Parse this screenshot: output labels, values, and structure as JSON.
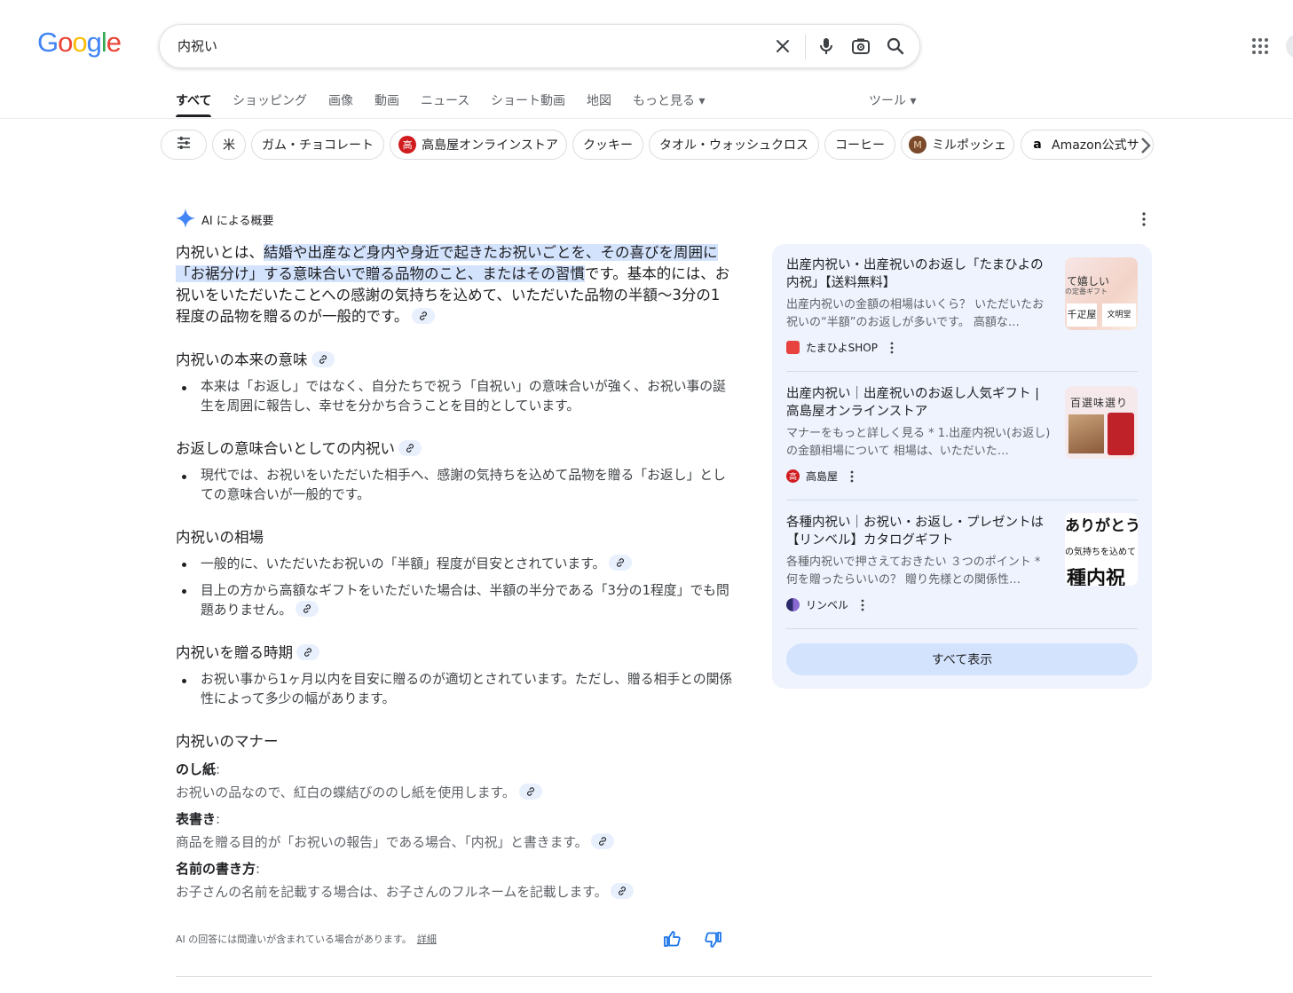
{
  "logo": [
    "G",
    "o",
    "o",
    "g",
    "l",
    "e"
  ],
  "logo_colors": [
    "#4285f4",
    "#ea4335",
    "#fbbc05",
    "#4285f4",
    "#34a853",
    "#ea4335"
  ],
  "search": {
    "query": "内祝い"
  },
  "tabs": [
    {
      "label": "すべて",
      "active": true
    },
    {
      "label": "ショッピング"
    },
    {
      "label": "画像"
    },
    {
      "label": "動画"
    },
    {
      "label": "ニュース"
    },
    {
      "label": "ショート動画"
    },
    {
      "label": "地図"
    },
    {
      "label": "もっと見る ▾"
    },
    {
      "label": "ツール ▾"
    }
  ],
  "chips": [
    {
      "label": ""
    },
    {
      "label": "米"
    },
    {
      "label": "ガム・チョコレート"
    },
    {
      "label": "高島屋オンラインストア",
      "icon": "高"
    },
    {
      "label": "クッキー"
    },
    {
      "label": "タオル・ウォッシュクロス"
    },
    {
      "label": "コーヒー"
    },
    {
      "label": "ミルポッシェ",
      "icon": "M"
    },
    {
      "label": "Amazon公式サ",
      "icon": "a"
    }
  ],
  "ai": {
    "title": "AI による概要",
    "intro_before": "内祝いとは、",
    "intro_highlight": "結婚や出産など身内や身近で起きたお祝いごとを、その喜びを周囲に「お裾分け」する意味合いで贈る品物のこと、またはその習慣",
    "intro_after": "です。基本的には、お祝いをいただいたことへの感謝の気持ちを込めて、いただいた品物の半額〜3分の1程度の品物を贈るのが一般的です。",
    "sections": [
      {
        "heading": "内祝いの本来の意味",
        "bullets": [
          "本来は「お返し」ではなく、自分たちで祝う「自祝い」の意味合いが強く、お祝い事の誕生を周囲に報告し、幸せを分かち合うことを目的としています。"
        ]
      },
      {
        "heading": "お返しの意味合いとしての内祝い",
        "bullets": [
          "現代では、お祝いをいただいた相手へ、感謝の気持ちを込めて品物を贈る「お返し」としての意味合いが一般的です。"
        ]
      },
      {
        "heading": "内祝いの相場",
        "bullets": [
          "一般的に、いただいたお祝いの「半額」程度が目安とされています。",
          "目上の方から高額なギフトをいただいた場合は、半額の半分である「3分の1程度」でも問題ありません。"
        ]
      },
      {
        "heading": "内祝いを贈る時期",
        "bullets": [
          "お祝い事から1ヶ月以内を目安に贈るのが適切とされています。ただし、贈る相手との関係性によって多少の幅があります。"
        ]
      }
    ],
    "manners": {
      "heading": "内祝いのマナー",
      "items": [
        {
          "label": "のし紙",
          "desc": "お祝いの品なので、紅白の蝶結びののし紙を使用します。"
        },
        {
          "label": "表書き",
          "desc": "商品を贈る目的が「お祝いの報告」である場合、「内祝」と書きます。"
        },
        {
          "label": "名前の書き方",
          "desc": "お子さんの名前を記載する場合は、お子さんのフルネームを記載します。"
        }
      ]
    },
    "disclaimer": "AI の回答には間違いが含まれている場合があります。",
    "disclaimer_link": "詳細"
  },
  "sources": [
    {
      "title": "出産内祝い・出産祝いのお返し「たまひよの内祝」【送料無料】",
      "snippet": "出産内祝いの金額の相場はいくら？ いただいたお祝いの“半額”のお返しが多いです。 高額な…",
      "site": "たまひよSHOP",
      "img_lines": [
        "て嬉しい",
        "の定番ギフト",
        "千疋屋",
        "文明堂"
      ]
    },
    {
      "title": "出産内祝い｜出産祝いのお返し人気ギフト | 高島屋オンラインストア",
      "snippet": "マナーをもっと詳しく見る * 1.出産内祝い(お返し)の金額相場について 相場は、いただいた…",
      "site": "高島屋",
      "img_lines": [
        "百選味選り"
      ]
    },
    {
      "title": "各種内祝い｜お祝い・お返し・プレゼントは【リンベル】カタログギフト",
      "snippet": "各種内祝いで押さえておきたい ３つのポイント * 何を贈ったらいいの？ 贈り先様との関係性…",
      "site": "リンベル",
      "img_lines": [
        "ありがとう",
        "の気持ちを込めて",
        "種内祝"
      ]
    }
  ],
  "show_all": "すべて表示",
  "colors": {
    "accent_blue": "#1a73e8",
    "chip_border": "#dadce0",
    "panel_bg": "#eef3fd",
    "highlight": "#d3e3fd"
  }
}
